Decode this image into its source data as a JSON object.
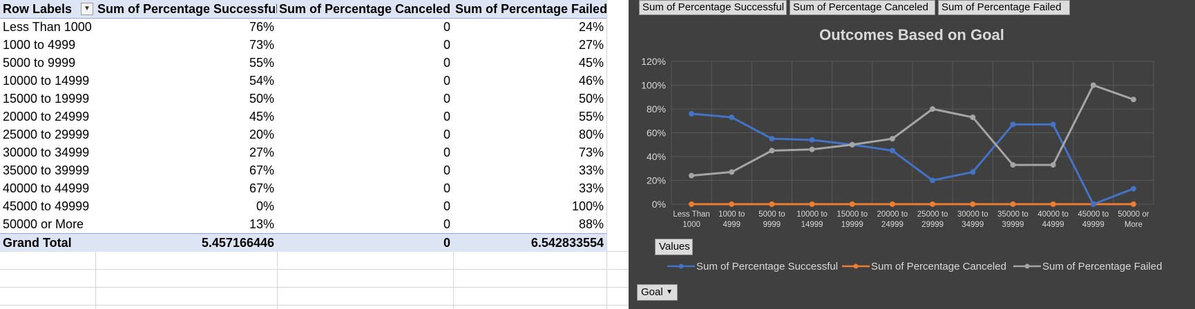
{
  "pivot": {
    "headers": [
      "Row Labels",
      "Sum of Percentage Successful",
      "Sum of Percentage Canceled",
      "Sum of Percentage Failed"
    ],
    "rows": [
      [
        "Less Than 1000",
        "76%",
        "0",
        "24%"
      ],
      [
        "1000 to 4999",
        "73%",
        "0",
        "27%"
      ],
      [
        "5000 to 9999",
        "55%",
        "0",
        "45%"
      ],
      [
        "10000 to 14999",
        "54%",
        "0",
        "46%"
      ],
      [
        "15000 to 19999",
        "50%",
        "0",
        "50%"
      ],
      [
        "20000 to 24999",
        "45%",
        "0",
        "55%"
      ],
      [
        "25000 to 29999",
        "20%",
        "0",
        "80%"
      ],
      [
        "30000 to 34999",
        "27%",
        "0",
        "73%"
      ],
      [
        "35000 to 39999",
        "67%",
        "0",
        "33%"
      ],
      [
        "40000 to 44999",
        "67%",
        "0",
        "33%"
      ],
      [
        "45000 to 49999",
        "0%",
        "0",
        "100%"
      ],
      [
        "50000 or More",
        "13%",
        "0",
        "88%"
      ]
    ],
    "total": [
      "Grand Total",
      "5.457166446",
      "0",
      "6.542833554"
    ]
  },
  "chart_panel": {
    "field_buttons": [
      "Sum of Percentage Successful",
      "Sum of Percentage Canceled",
      "Sum of Percentage Failed"
    ],
    "values_button": "Values",
    "goal_button": "Goal",
    "dropdown_glyph": "▼"
  },
  "chart_data": {
    "type": "line",
    "title": "Outcomes Based on Goal",
    "categories": [
      [
        "Less Than",
        "1000"
      ],
      [
        "1000 to",
        "4999"
      ],
      [
        "5000 to",
        "9999"
      ],
      [
        "10000 to",
        "14999"
      ],
      [
        "15000 to",
        "19999"
      ],
      [
        "20000 to",
        "24999"
      ],
      [
        "25000 to",
        "29999"
      ],
      [
        "30000 to",
        "34999"
      ],
      [
        "35000 to",
        "39999"
      ],
      [
        "40000 to",
        "44999"
      ],
      [
        "45000 to",
        "49999"
      ],
      [
        "50000 or",
        "More"
      ]
    ],
    "yticks": [
      "0%",
      "20%",
      "40%",
      "60%",
      "80%",
      "100%",
      "120%"
    ],
    "ylim": [
      0,
      1.2
    ],
    "grid": true,
    "legend_position": "bottom",
    "series": [
      {
        "name": "Sum of Percentage Successful",
        "color": "#4472c4",
        "values": [
          0.76,
          0.73,
          0.55,
          0.54,
          0.5,
          0.45,
          0.2,
          0.27,
          0.67,
          0.67,
          0.0,
          0.13
        ]
      },
      {
        "name": "Sum of Percentage Canceled",
        "color": "#ed7d31",
        "values": [
          0,
          0,
          0,
          0,
          0,
          0,
          0,
          0,
          0,
          0,
          0,
          0
        ]
      },
      {
        "name": "Sum of Percentage Failed",
        "color": "#a5a5a5",
        "values": [
          0.24,
          0.27,
          0.45,
          0.46,
          0.5,
          0.55,
          0.8,
          0.73,
          0.33,
          0.33,
          1.0,
          0.88
        ]
      }
    ]
  }
}
